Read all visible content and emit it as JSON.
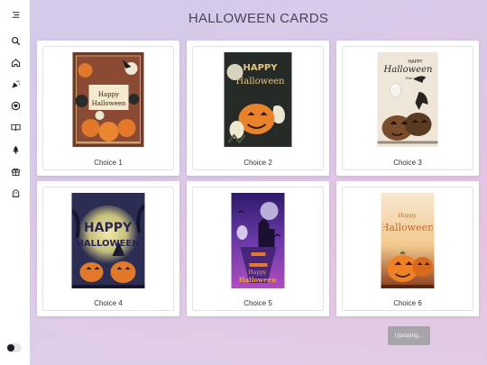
{
  "sidebar": {
    "icons": [
      {
        "name": "menu-collapse-icon"
      },
      {
        "name": "search-icon"
      },
      {
        "name": "home-icon"
      },
      {
        "name": "party-popper-icon"
      },
      {
        "name": "heart-badge-icon"
      },
      {
        "name": "book-open-icon"
      },
      {
        "name": "christmas-tree-icon"
      },
      {
        "name": "gift-icon"
      },
      {
        "name": "ghost-icon"
      }
    ],
    "theme_toggle": "dark-mode-toggle"
  },
  "main": {
    "title": "HALLOWEEN CARDS",
    "cards": [
      {
        "label": "Choice 1",
        "art": {
          "title": "Happy Halloween",
          "bg": "#6e3b2c"
        }
      },
      {
        "label": "Choice 2",
        "art": {
          "title": "Happy Halloween",
          "bg": "#2a2f2a"
        }
      },
      {
        "label": "Choice 3",
        "art": {
          "title": "Halloween",
          "subtitle": "Trick or Treat",
          "bg": "#efe6da"
        }
      },
      {
        "label": "Choice 4",
        "art": {
          "title": "Happy Halloween",
          "bg": "#2b2d52"
        }
      },
      {
        "label": "Choice 5",
        "art": {
          "title": "Happy Halloween",
          "bg": "#4a2a7a"
        }
      },
      {
        "label": "Choice 6",
        "art": {
          "title": "Halloween",
          "subtitle": "Happy",
          "bg": "#f6e2c4"
        }
      }
    ],
    "status": "Updating..."
  },
  "colors": {
    "title": "#4a4356",
    "status_bg": "#a8a4ab"
  }
}
